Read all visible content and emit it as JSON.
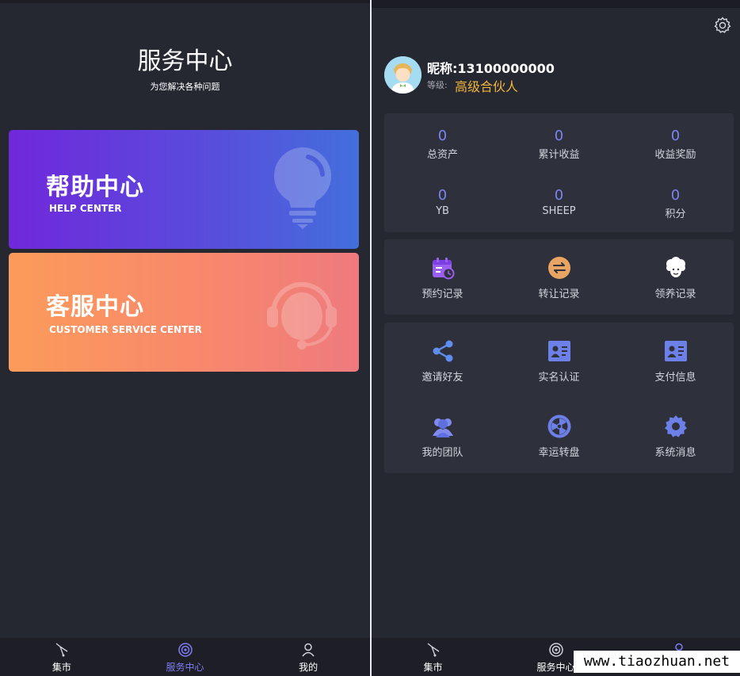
{
  "left": {
    "title": "服务中心",
    "subtitle": "为您解决各种问题",
    "cards": [
      {
        "title": "帮助中心",
        "subtitle": "HELP CENTER",
        "icon": "lightbulb-icon"
      },
      {
        "title": "客服中心",
        "subtitle": "CUSTOMER SERVICE CENTER",
        "icon": "headset-agent-icon"
      }
    ],
    "tabs": [
      {
        "label": "集市",
        "icon": "market-icon"
      },
      {
        "label": "服务中心",
        "icon": "service-center-icon",
        "active": true
      },
      {
        "label": "我的",
        "icon": "person-icon"
      }
    ]
  },
  "right": {
    "nickname": "昵称:13100000000",
    "level_label": "等级:",
    "level_value": "高级合伙人",
    "stats": [
      {
        "value": "0",
        "label": "总资产"
      },
      {
        "value": "0",
        "label": "累计收益"
      },
      {
        "value": "0",
        "label": "收益奖励"
      },
      {
        "value": "0",
        "label": "YB"
      },
      {
        "value": "0",
        "label": "SHEEP"
      },
      {
        "value": "0",
        "label": "积分"
      }
    ],
    "records": [
      {
        "label": "预约记录",
        "icon": "calendar-clock-icon"
      },
      {
        "label": "转让记录",
        "icon": "transfer-icon"
      },
      {
        "label": "领养记录",
        "icon": "sheep-icon"
      }
    ],
    "menu": [
      {
        "label": "邀请好友",
        "icon": "share-icon"
      },
      {
        "label": "实名认证",
        "icon": "id-card-icon"
      },
      {
        "label": "支付信息",
        "icon": "payment-card-icon"
      },
      {
        "label": "我的团队",
        "icon": "team-icon"
      },
      {
        "label": "幸运转盘",
        "icon": "lucky-wheel-icon"
      },
      {
        "label": "系统消息",
        "icon": "gear-icon"
      }
    ],
    "tabs": [
      {
        "label": "集市",
        "icon": "market-icon"
      },
      {
        "label": "服务中心",
        "icon": "service-center-icon"
      }
    ]
  },
  "watermark": "www.tiaozhuan.net",
  "colors": {
    "background": "#252731",
    "box": "#2e303b",
    "accent": "#7c84ef",
    "level": "#f0b53a",
    "active_tab": "#7f7cf5"
  }
}
